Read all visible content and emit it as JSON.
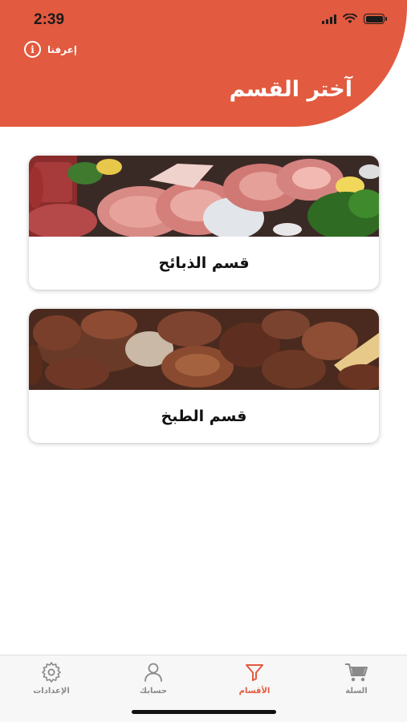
{
  "status_bar": {
    "time": "2:39"
  },
  "header": {
    "about_label": "إعرفنا",
    "about_icon": "info-icon",
    "title": "آختر القسم",
    "background_color": "#e25a3f"
  },
  "sections": [
    {
      "label": "قسم الذبائح",
      "image": "raw-meat-photo"
    },
    {
      "label": "قسم الطبخ",
      "image": "cooked-meat-photo"
    }
  ],
  "tabbar": {
    "active_color": "#e25a3f",
    "inactive_color": "#8a8a8a",
    "items": [
      {
        "label": "الإعدادات",
        "icon": "gear-icon",
        "active": false
      },
      {
        "label": "حسابك",
        "icon": "user-icon",
        "active": false
      },
      {
        "label": "الأقسام",
        "icon": "filter-icon",
        "active": true
      },
      {
        "label": "السلة",
        "icon": "cart-icon",
        "active": false
      }
    ]
  }
}
